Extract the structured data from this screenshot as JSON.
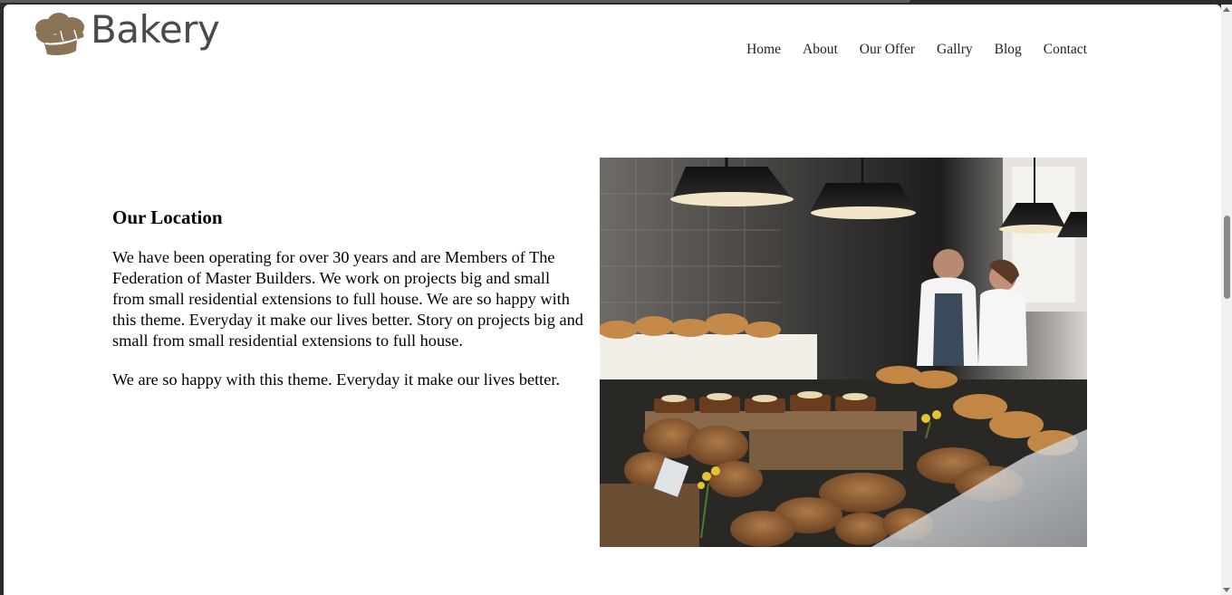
{
  "brand": {
    "name": "Bakery",
    "logo_icon": "chef-hat-icon",
    "logo_color": "#8b7355"
  },
  "nav": {
    "items": [
      "Home",
      "About",
      "Our Offer",
      "Gallry",
      "Blog",
      "Contact"
    ]
  },
  "section": {
    "title": "Our Location",
    "paragraph1": "We have been operating for over 30 years and are Members of The Federation of Master Builders. We work on projects big and small from small residential extensions to full house. We are so happy with this theme. Everyday it make our lives better. Story on projects big and small from small residential extensions to full house.",
    "paragraph2": "We are so happy with this theme. Everyday it make our lives better."
  },
  "image": {
    "subject": "bakery-counter-photo"
  }
}
